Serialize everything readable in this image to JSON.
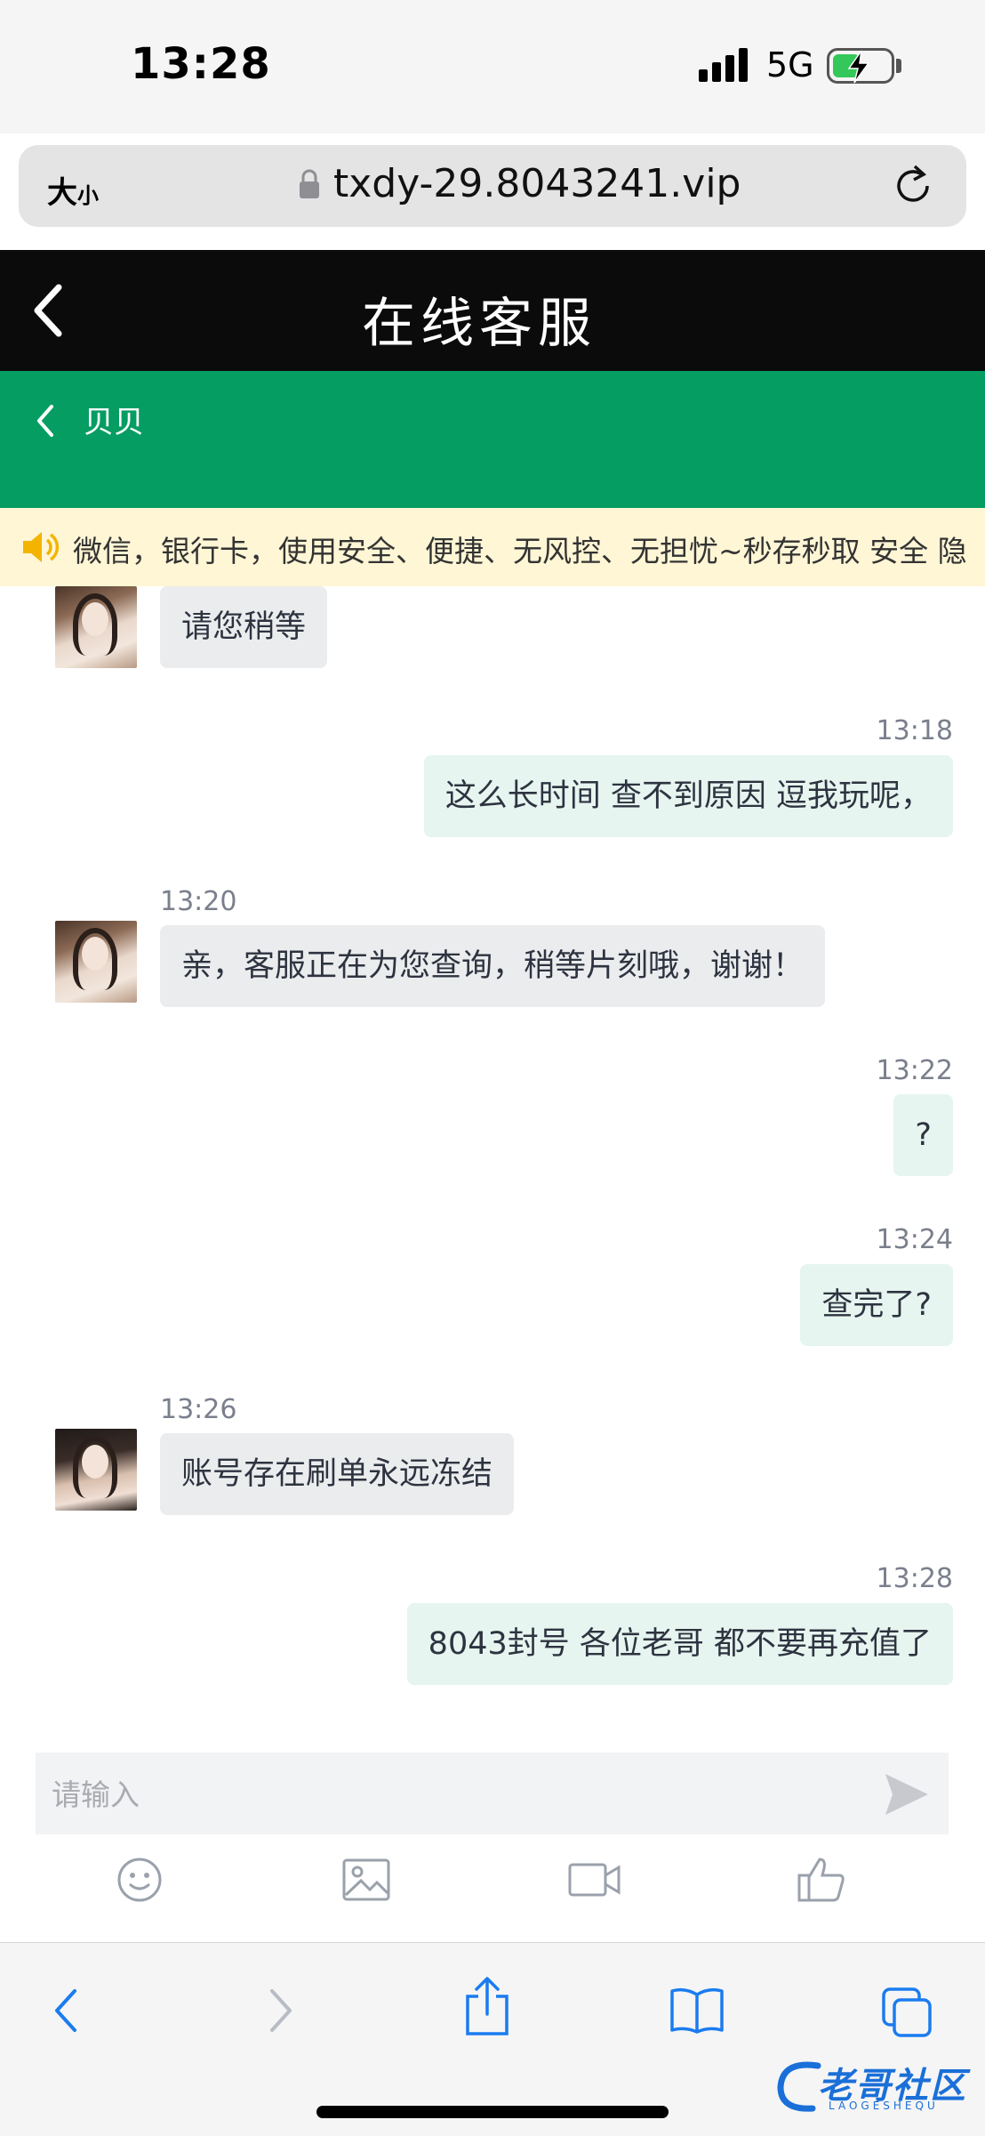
{
  "status_bar": {
    "time": "13:28",
    "network": "5G"
  },
  "browser": {
    "text_size_label": "大",
    "text_size_small": "小",
    "url": "txdy-29.8043241.vip"
  },
  "header": {
    "title": "在线客服"
  },
  "agent": {
    "name": "贝贝"
  },
  "notice": {
    "text": "微信，银行卡，使用安全、便捷、无风控、无担忧~秒存秒取 安全 隐"
  },
  "messages": [
    {
      "side": "left",
      "time": "",
      "text": "请您稍等"
    },
    {
      "side": "right",
      "time": "13:18",
      "text": "这么长时间 查不到原因 逗我玩呢，"
    },
    {
      "side": "left",
      "time": "13:20",
      "text": "亲，客服正在为您查询，稍等片刻哦，谢谢！"
    },
    {
      "side": "right",
      "time": "13:22",
      "text": "?"
    },
    {
      "side": "right",
      "time": "13:24",
      "text": "查完了?"
    },
    {
      "side": "left",
      "time": "13:26",
      "text": "账号存在刷单永远冻结"
    },
    {
      "side": "right",
      "time": "13:28",
      "text": "8043封号 各位老哥 都不要再充值了"
    }
  ],
  "input": {
    "placeholder": "请输入"
  },
  "toolbar_icons": [
    "emoji-icon",
    "image-icon",
    "video-icon",
    "thumbs-up-icon"
  ],
  "safari_bar_icons": [
    "back-icon",
    "forward-icon",
    "share-icon",
    "bookmarks-icon",
    "tabs-icon"
  ],
  "watermark": {
    "text": "老哥社区",
    "sub": "LAOGESHEQU"
  },
  "colors": {
    "header_bg": "#0b0b0b",
    "agent_bar": "#069d62",
    "notice_bg": "#fff6d5",
    "bubble_left": "#ebeced",
    "bubble_right": "#e6f5ef",
    "ios_blue": "#1a7cf0"
  }
}
